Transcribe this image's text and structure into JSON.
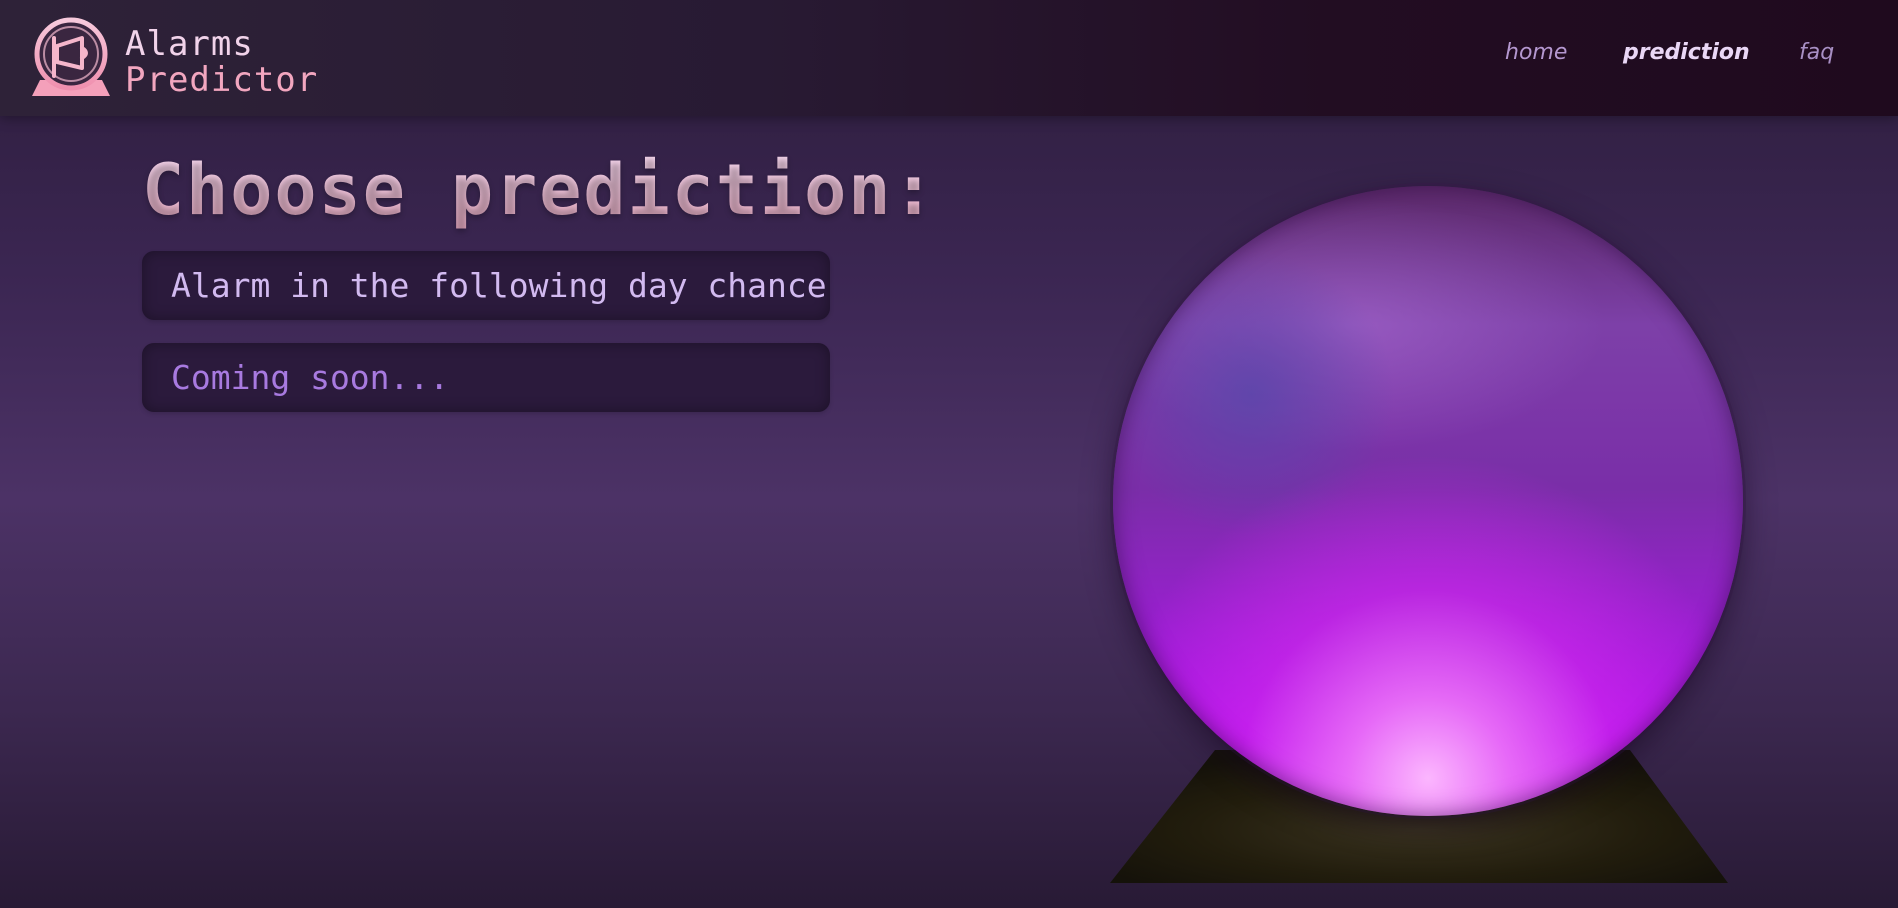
{
  "header": {
    "brand_line1": "Alarms",
    "brand_line2": "Predictor",
    "logo_icon": "megaphone-icon",
    "nav": {
      "home": "home",
      "prediction": "prediction",
      "faq": "faq"
    },
    "active_nav": "prediction"
  },
  "main": {
    "title": "Choose prediction:",
    "options": [
      {
        "label": "Alarm in the following day chance"
      },
      {
        "label": "Coming soon..."
      }
    ]
  },
  "illustration": {
    "name": "crystal-ball",
    "colors": {
      "ball_glow": "#c030f0",
      "stand": "#2a2410"
    }
  },
  "colors": {
    "background": "#3b2652",
    "header": "#281a33",
    "accent_pink": "#f2a6bf",
    "text_lilac": "#d2baf0"
  }
}
